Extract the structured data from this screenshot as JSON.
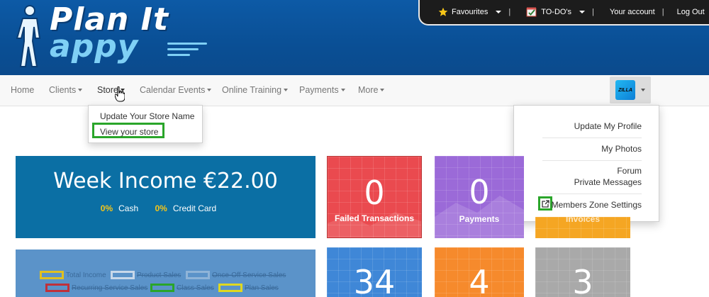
{
  "brand": {
    "line1": "Plan It",
    "line2": "appy"
  },
  "topbar": {
    "favourites": "Favourites",
    "todos": "TO-DO's",
    "account": "Your account",
    "logout": "Log Out",
    "sep": "|"
  },
  "nav": {
    "home": "Home",
    "clients": "Clients",
    "store": "Store",
    "calendar": "Calendar Events",
    "training": "Online Training",
    "payments": "Payments",
    "more": "More"
  },
  "avatar": {
    "label": "ZILLA"
  },
  "store_menu": {
    "update_name": "Update Your Store Name",
    "view_store": "View your store"
  },
  "profile_menu": {
    "update_profile": "Update My Profile",
    "photos": "My Photos",
    "forum": "Forum",
    "messages": "Private Messages",
    "members_zone": "Members Zone Settings"
  },
  "income": {
    "title": "Week Income €22.00",
    "cash_pct": "0%",
    "cash_label": "Cash",
    "card_pct": "0%",
    "card_label": "Credit Card"
  },
  "tiles": [
    {
      "value": "0",
      "label": "Failed Transactions",
      "color": "#ea4a4f"
    },
    {
      "value": "0",
      "label": "Payments",
      "color": "#9b6ad8"
    },
    {
      "value": "",
      "label": "Invoices",
      "color": "#f5a623"
    },
    {
      "value": "34",
      "label": "",
      "color": "#3f87d7"
    },
    {
      "value": "4",
      "label": "",
      "color": "#f68a2c"
    },
    {
      "value": "3",
      "label": "",
      "color": "#a9a9a9"
    }
  ],
  "chart_legend": {
    "total_income": "Total Income",
    "product_sales": "Product Sales",
    "once_off": "Once-Off Service Sales",
    "recurring": "Recurring Service Sales",
    "class_sales": "Class Sales",
    "plan_sales": "Plan Sales"
  },
  "colors": {
    "header": "#0b5aa3",
    "highlight": "#2aa52a",
    "income_panel": "#0b6fa4",
    "pct_yellow": "#f5c518"
  }
}
